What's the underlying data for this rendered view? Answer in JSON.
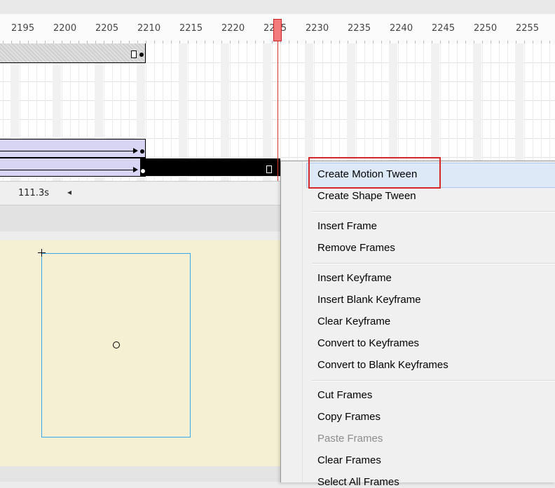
{
  "timeline": {
    "frame_labels": [
      "2195",
      "2200",
      "2205",
      "2210",
      "2215",
      "2220",
      "2225",
      "2230",
      "2235",
      "2240",
      "2245",
      "2250",
      "2255"
    ],
    "current_frame": 2225
  },
  "status": {
    "elapsed_time": "111.3s",
    "scroll_left_glyph": "◂"
  },
  "context_menu": {
    "groups": [
      [
        {
          "label": "Create Motion Tween",
          "highlighted": true
        },
        {
          "label": "Create Shape Tween"
        }
      ],
      [
        {
          "label": "Insert Frame"
        },
        {
          "label": "Remove Frames"
        }
      ],
      [
        {
          "label": "Insert Keyframe"
        },
        {
          "label": "Insert Blank Keyframe"
        },
        {
          "label": "Clear Keyframe"
        },
        {
          "label": "Convert to Keyframes"
        },
        {
          "label": "Convert to Blank Keyframes"
        }
      ],
      [
        {
          "label": "Cut Frames"
        },
        {
          "label": "Copy Frames"
        },
        {
          "label": "Paste Frames",
          "disabled": true
        },
        {
          "label": "Clear Frames"
        },
        {
          "label": "Select All Frames"
        }
      ]
    ]
  },
  "colors": {
    "highlight_outline": "#d62828",
    "playhead": "#d33333",
    "tween_fill": "#d8d4f4",
    "stage": "#f5f0d3",
    "selection_box": "#33aaee"
  }
}
